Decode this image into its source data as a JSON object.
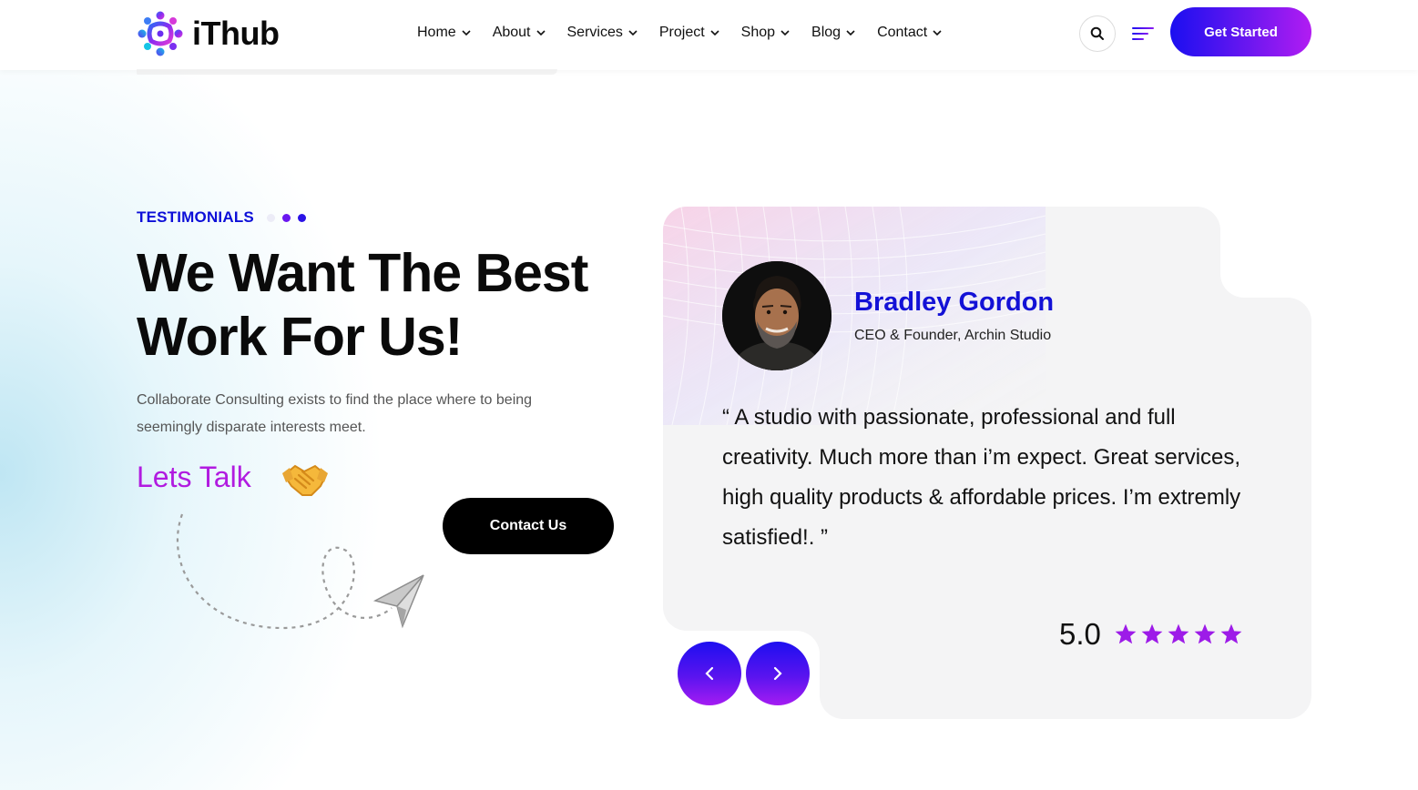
{
  "brand": {
    "name": "iThub"
  },
  "nav": [
    {
      "label": "Home"
    },
    {
      "label": "About"
    },
    {
      "label": "Services"
    },
    {
      "label": "Project"
    },
    {
      "label": "Shop"
    },
    {
      "label": "Blog"
    },
    {
      "label": "Contact"
    }
  ],
  "header": {
    "cta_label": "Get Started"
  },
  "testimonials": {
    "eyebrow": "TESTIMONIALS",
    "headline_line1": "We Want The Best",
    "headline_line2": "Work For Us!",
    "description": "Collaborate Consulting exists to find the place where to being seemingly disparate interests meet.",
    "lets_talk": "Lets Talk",
    "contact_label": "Contact Us"
  },
  "review": {
    "name": "Bradley Gordon",
    "role": "CEO & Founder, Archin Studio",
    "quote": "“ A studio with passionate, professional and full creativity. Much more than i’m expect. Great services, high quality products & affordable prices. I’m extremly satisfied!. ”",
    "rating": "5.0",
    "stars": 5
  },
  "colors": {
    "accent_blue": "#1311d6",
    "accent_purple": "#b11be0",
    "card_bg": "#f4f4f5"
  },
  "icons": {
    "search": "search-icon",
    "menu": "hamburger-icon",
    "prev": "chevron-left-icon",
    "next": "chevron-right-icon"
  }
}
